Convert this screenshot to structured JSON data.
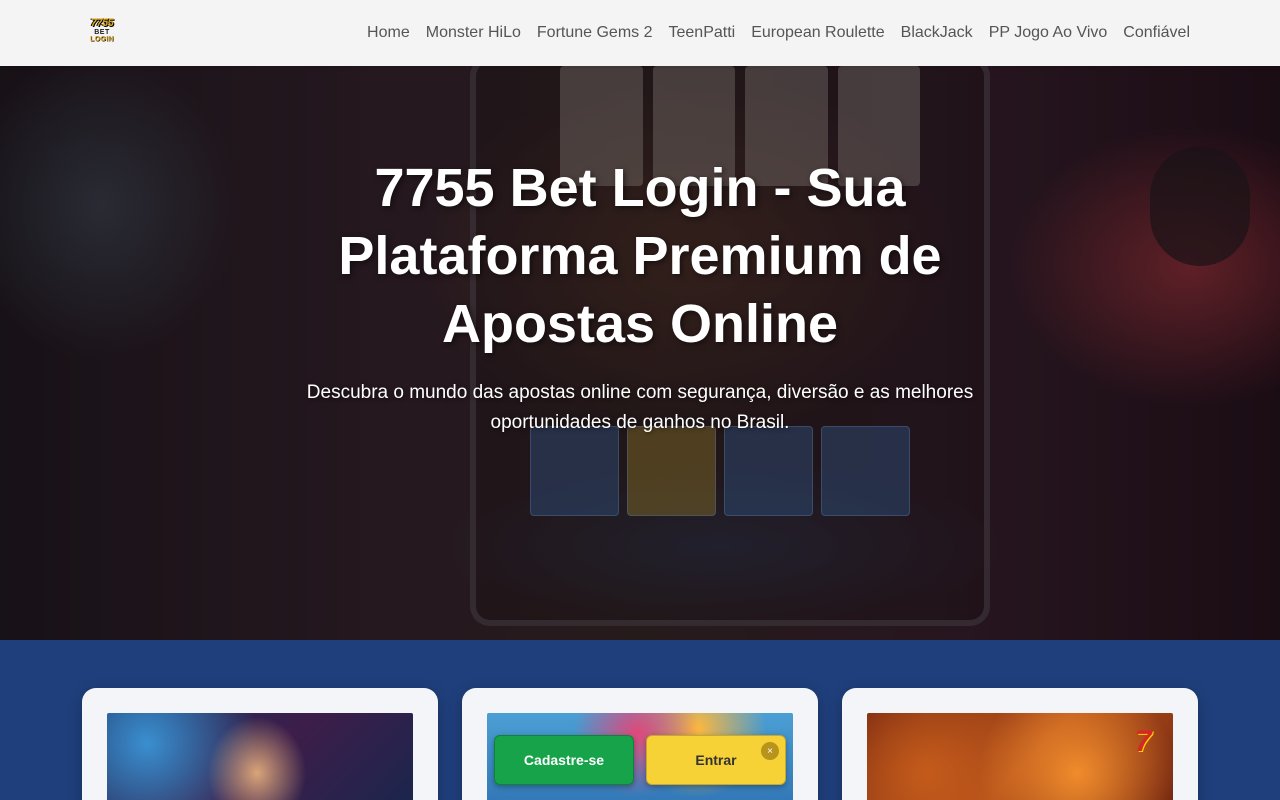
{
  "header": {
    "logo": {
      "line1": "7755",
      "line2": "BET",
      "line3": "LOGIN"
    },
    "nav": [
      {
        "label": "Home"
      },
      {
        "label": "Monster HiLo"
      },
      {
        "label": "Fortune Gems 2"
      },
      {
        "label": "TeenPatti"
      },
      {
        "label": "European Roulette"
      },
      {
        "label": "BlackJack"
      },
      {
        "label": "PP Jogo Ao Vivo"
      },
      {
        "label": "Confiável"
      }
    ]
  },
  "hero": {
    "title": "7755 Bet Login - Sua Plataforma Premium de Apostas Online",
    "subtitle": "Descubra o mundo das apostas online com segurança, diversão e as melhores oportunidades de ganhos no Brasil."
  },
  "cards": [
    {
      "image": "casino-woman-image"
    },
    {
      "image": "slot-game-image"
    },
    {
      "image": "fox-slot-image",
      "badge": "7"
    }
  ],
  "cta": {
    "register_label": "Cadastre-se",
    "login_label": "Entrar",
    "close_icon": "×"
  },
  "colors": {
    "header_bg": "#f4f4f4",
    "section_bg": "#1f3f7c",
    "register_btn": "#16a34a",
    "login_btn": "#f7d237"
  }
}
